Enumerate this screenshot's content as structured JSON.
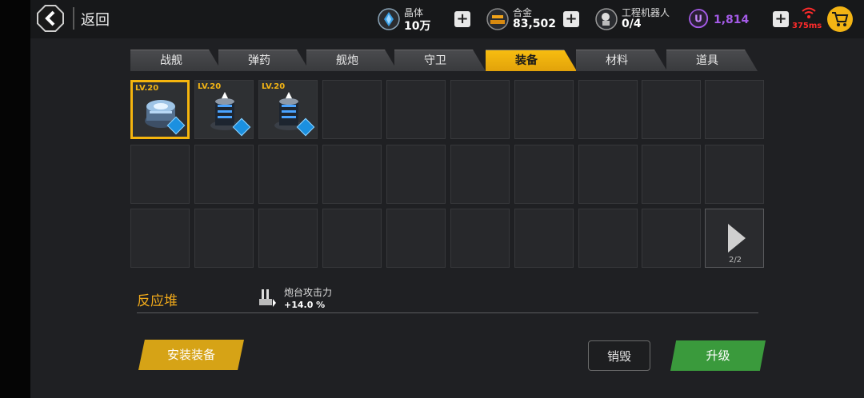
{
  "header": {
    "back_label": "返回",
    "resources": [
      {
        "name": "晶体",
        "value": "10万",
        "icon": "crystal-icon",
        "color": "#3aa0e6"
      },
      {
        "name": "合金",
        "value": "83,502",
        "icon": "alloy-icon",
        "color": "#f0a31a"
      },
      {
        "name": "工程机器人",
        "value": "0/4",
        "icon": "robot-icon",
        "color": "#dddddd"
      }
    ],
    "premium": {
      "value": "1,814",
      "icon": "u-coin-icon",
      "color": "#a55be8"
    },
    "ping": "375ms",
    "ping_color": "#ff2b2b"
  },
  "tabs": [
    {
      "label": "战舰",
      "active": false
    },
    {
      "label": "弹药",
      "active": false
    },
    {
      "label": "舰炮",
      "active": false
    },
    {
      "label": "守卫",
      "active": false
    },
    {
      "label": "装备",
      "active": true
    },
    {
      "label": "材料",
      "active": false
    },
    {
      "label": "道具",
      "active": false
    }
  ],
  "inventory": {
    "items": [
      {
        "level": "LV.20",
        "selected": true,
        "icon": "reactor-core-icon"
      },
      {
        "level": "LV.20",
        "selected": false,
        "icon": "turret-tower-icon"
      },
      {
        "level": "LV.20",
        "selected": false,
        "icon": "turret-tower-icon"
      }
    ],
    "page": "2/2"
  },
  "detail": {
    "item_name": "反应堆",
    "stat_name": "炮台攻击力",
    "stat_value": "+14.0 %",
    "stat_icon": "turret-attack-icon"
  },
  "actions": {
    "install": "安装装备",
    "destroy": "销毁",
    "upgrade": "升级"
  },
  "accent": "#f5b50e"
}
